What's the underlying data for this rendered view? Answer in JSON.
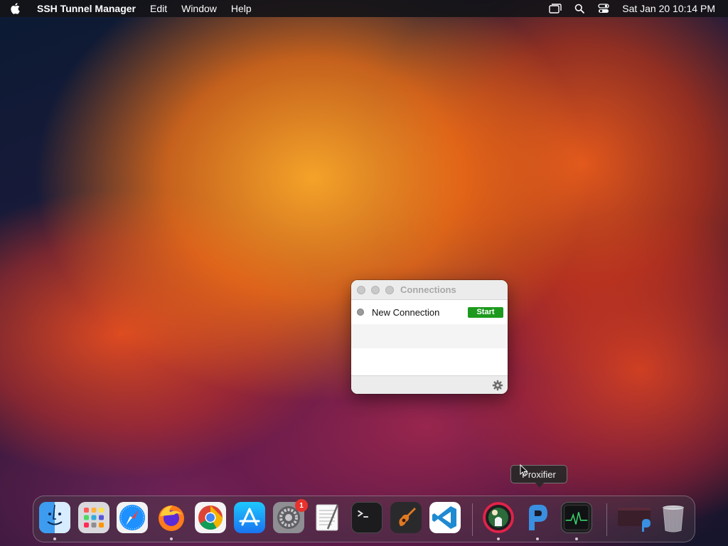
{
  "menubar": {
    "app_name": "SSH Tunnel Manager",
    "menus": [
      "Edit",
      "Window",
      "Help"
    ],
    "clock": "Sat Jan 20  10:14 PM"
  },
  "window": {
    "title": "Connections",
    "connections": [
      {
        "name": "New Connection",
        "status": "stopped",
        "action_label": "Start"
      }
    ]
  },
  "tooltip": {
    "text": "Proxifier"
  },
  "dock": {
    "apps": [
      "Finder",
      "Launchpad",
      "Safari",
      "Firefox",
      "Google Chrome",
      "App Store",
      "System Settings",
      "TextEdit",
      "Terminal",
      "GarageBand",
      "Visual Studio Code",
      "SSH Tunnel Manager",
      "Proxifier",
      "Activity Monitor",
      "Proxifier Window",
      "Trash"
    ],
    "system_settings_badge": "1"
  },
  "colors": {
    "start_button": "#1d9a1d",
    "badge": "#e8322d"
  }
}
